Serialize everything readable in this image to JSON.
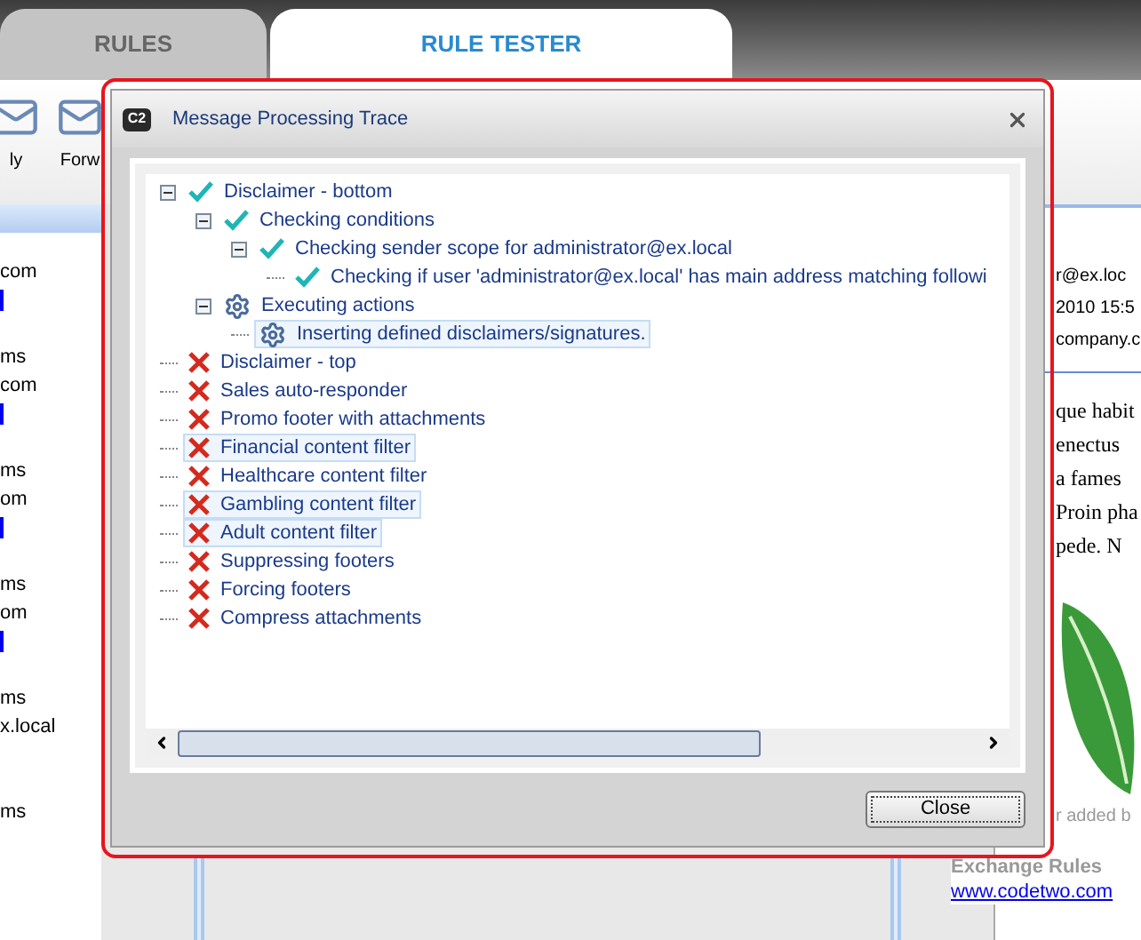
{
  "tabs": [
    {
      "label": "RULES",
      "selected": false
    },
    {
      "label": "RULE TESTER",
      "selected": true
    }
  ],
  "toolbar": [
    {
      "label": "ly"
    },
    {
      "label": "Forw"
    }
  ],
  "left_pane": [
    {
      "kind": "text",
      "text": "com"
    },
    {
      "kind": "link"
    },
    {
      "kind": "gap"
    },
    {
      "kind": "text",
      "text": "ms"
    },
    {
      "kind": "text",
      "text": "com"
    },
    {
      "kind": "link"
    },
    {
      "kind": "gap"
    },
    {
      "kind": "text",
      "text": "ms"
    },
    {
      "kind": "text",
      "text": "om"
    },
    {
      "kind": "link"
    },
    {
      "kind": "gap"
    },
    {
      "kind": "text",
      "text": "ms"
    },
    {
      "kind": "text",
      "text": "om"
    },
    {
      "kind": "link"
    },
    {
      "kind": "gap"
    },
    {
      "kind": "text",
      "text": "ms"
    },
    {
      "kind": "text",
      "text": "x.local"
    },
    {
      "kind": "gap"
    },
    {
      "kind": "gap"
    },
    {
      "kind": "text",
      "text": "ms"
    }
  ],
  "right_pane": {
    "header_lines": [
      "r@ex.loc",
      "2010 15:5",
      "company.c"
    ],
    "body_lines": [
      "que habit",
      "enectus",
      "a fames",
      "Proin pha",
      "pede. N"
    ],
    "footer": {
      "note": "r added b",
      "product": "Exchange Rules",
      "link": "www.codetwo.com"
    }
  },
  "dialog": {
    "logo_text": "C2",
    "title": "Message Processing Trace",
    "tree": [
      {
        "label": "Disclaimer - bottom",
        "kind": "check",
        "expanded": true,
        "selected": false,
        "children": [
          {
            "label": "Checking conditions",
            "kind": "check",
            "expanded": true,
            "selected": false,
            "children": [
              {
                "label": "Checking sender scope for administrator@ex.local",
                "kind": "check",
                "expanded": true,
                "selected": false,
                "children": [
                  {
                    "label": "Checking if user 'administrator@ex.local' has main address matching followi",
                    "kind": "check",
                    "selected": false
                  }
                ]
              }
            ]
          },
          {
            "label": "Executing actions",
            "kind": "gear",
            "expanded": true,
            "selected": false,
            "children": [
              {
                "label": "Inserting defined disclaimers/signatures.",
                "kind": "gear",
                "selected": true
              }
            ]
          }
        ]
      },
      {
        "label": "Disclaimer - top",
        "kind": "cross",
        "selected": false
      },
      {
        "label": "Sales auto-responder",
        "kind": "cross",
        "selected": false
      },
      {
        "label": "Promo footer with attachments",
        "kind": "cross",
        "selected": false
      },
      {
        "label": "Financial content filter",
        "kind": "cross",
        "selected": true
      },
      {
        "label": "Healthcare content filter",
        "kind": "cross",
        "selected": false
      },
      {
        "label": "Gambling content filter",
        "kind": "cross",
        "selected": true
      },
      {
        "label": "Adult content filter",
        "kind": "cross",
        "selected": true
      },
      {
        "label": "Suppressing footers",
        "kind": "cross",
        "selected": false
      },
      {
        "label": "Forcing footers",
        "kind": "cross",
        "selected": false
      },
      {
        "label": "Compress attachments",
        "kind": "cross",
        "selected": false
      }
    ],
    "buttons": [
      "Close"
    ]
  }
}
